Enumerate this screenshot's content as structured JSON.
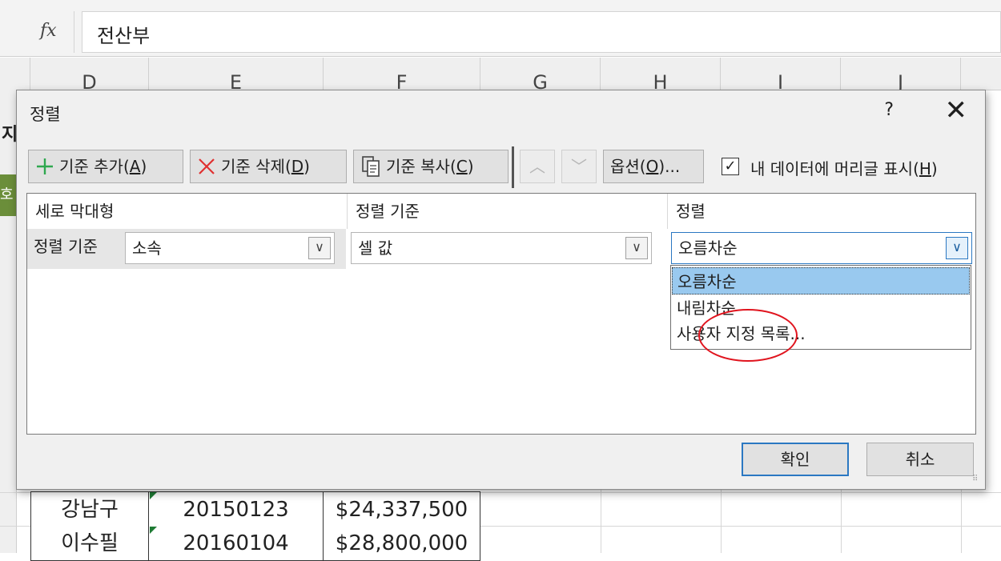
{
  "formula_bar": {
    "fx_label": "fx",
    "value": "전산부"
  },
  "columns": [
    "D",
    "E",
    "F",
    "G",
    "H",
    "I",
    "J"
  ],
  "sheet": {
    "partial_header": "지",
    "green_tag": "호",
    "rows": [
      {
        "name": "강남구",
        "code": "20150123",
        "amount": "$24,337,500"
      },
      {
        "name": "이수필",
        "code": "20160104",
        "amount": "$28,800,000"
      }
    ]
  },
  "dialog": {
    "title": "정렬",
    "help": "?",
    "close": "✕",
    "toolbar": {
      "add_level": {
        "text": "기준 추가(",
        "key": "A",
        "tail": ")"
      },
      "delete_level": {
        "text": "기준 삭제(",
        "key": "D",
        "tail": ")"
      },
      "copy_level": {
        "text": "기준 복사(",
        "key": "C",
        "tail": ")"
      },
      "move_up": "︿",
      "move_down": "﹀",
      "options": {
        "text": "옵션(",
        "key": "O",
        "tail": ")..."
      },
      "headers_checkbox": {
        "checked": "✓",
        "text": "내 데이터에 머리글 표시(",
        "key": "H",
        "tail": ")"
      }
    },
    "grid": {
      "headers": [
        "세로 막대형",
        "정렬 기준",
        "정렬"
      ],
      "row_label": "정렬 기준",
      "column_value": "소속",
      "sort_on_value": "셀 값",
      "order_value": "오름차순",
      "dropdown_arrow": "∨"
    },
    "order_options": [
      "오름차순",
      "내림차순",
      "사용자 지정 목록..."
    ],
    "selected_option_index": 0,
    "ok": "확인",
    "cancel": "취소"
  },
  "colors": {
    "accent": "#2b78c2",
    "highlight": "#99c9ef",
    "annotation": "#e0141e",
    "add_icon": "#2fa84f",
    "delete_icon": "#e03030"
  }
}
